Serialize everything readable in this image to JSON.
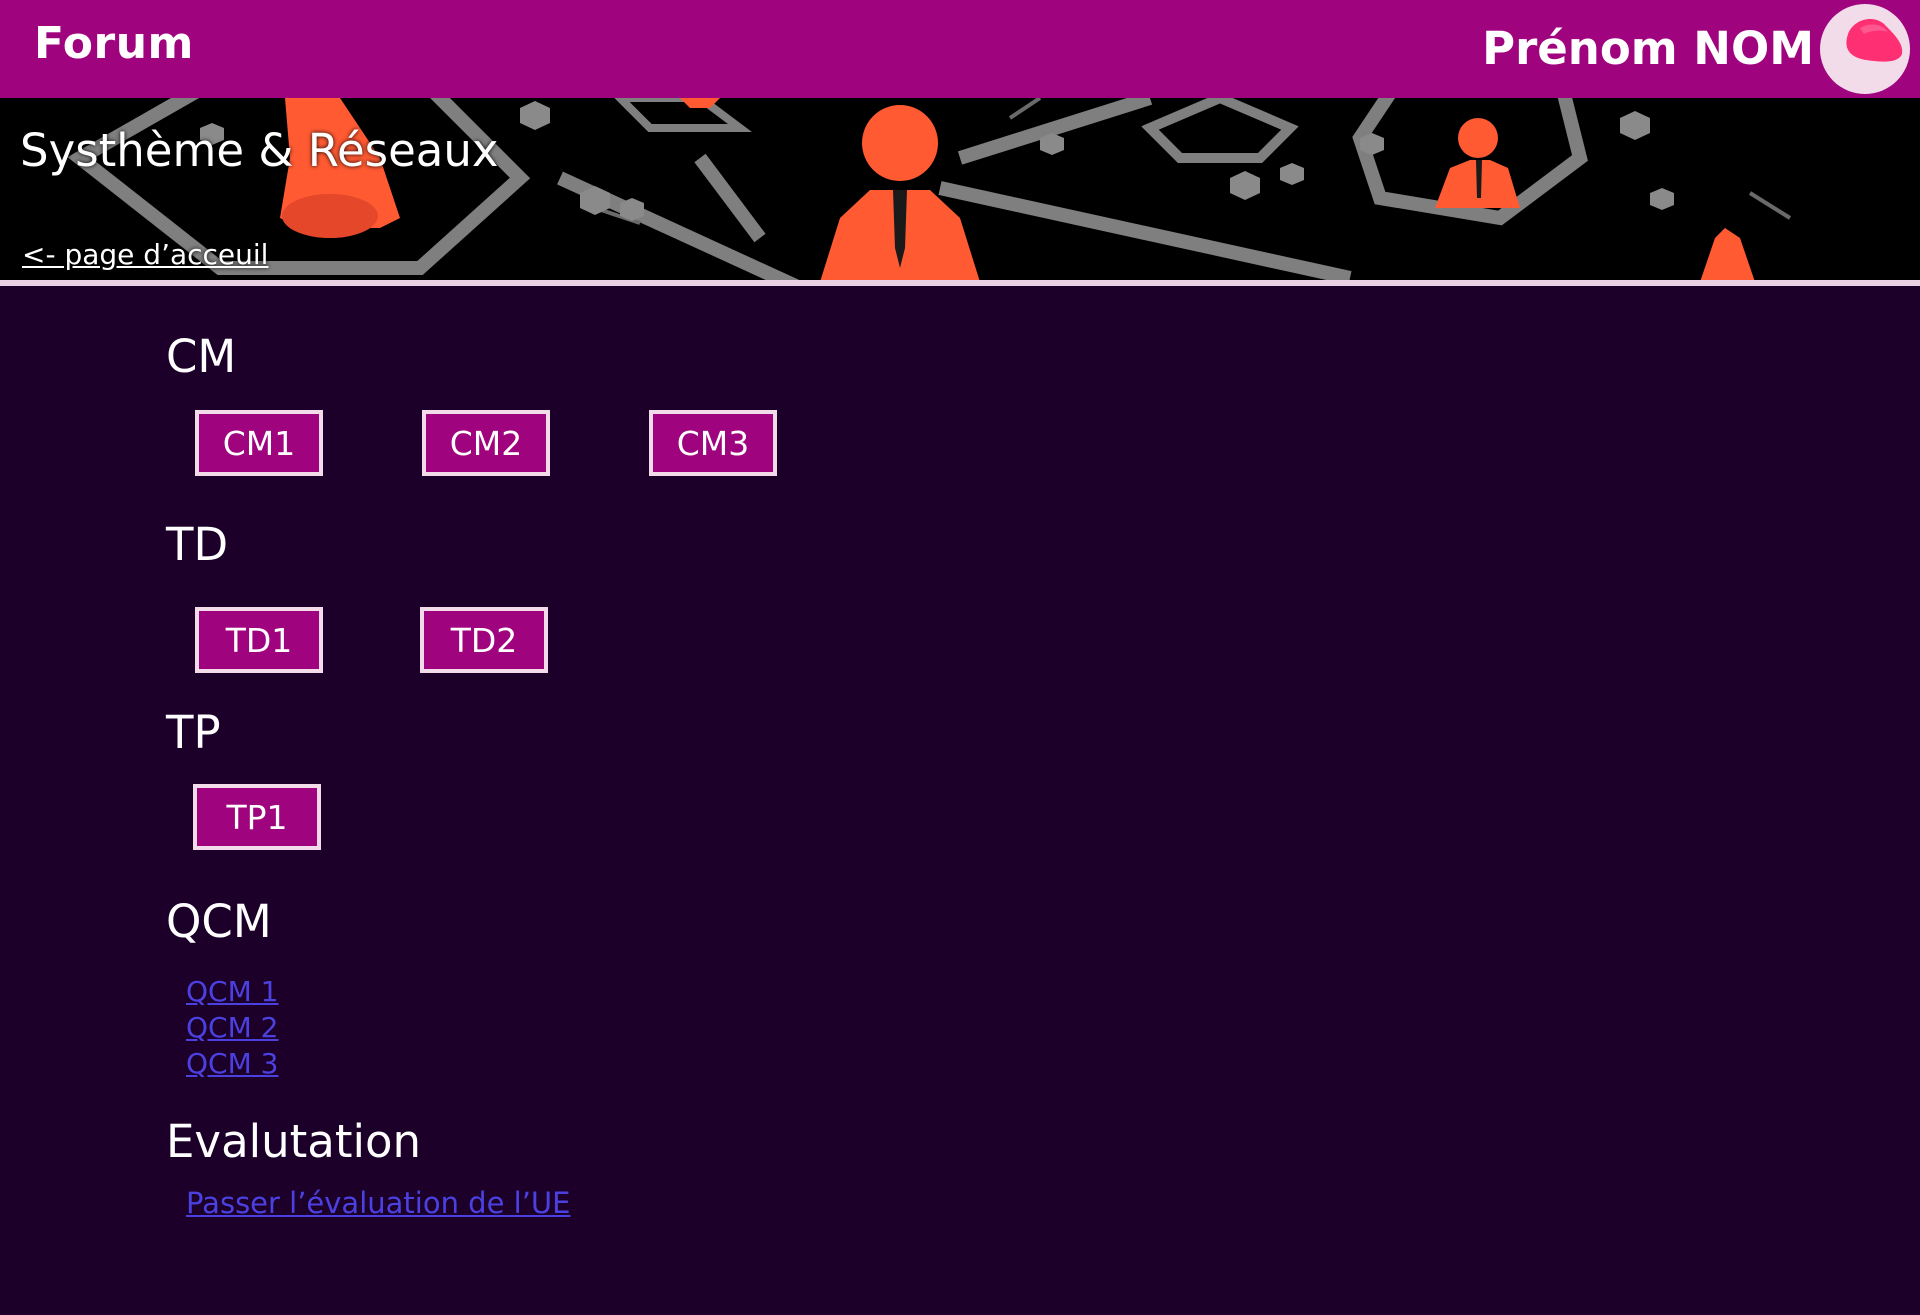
{
  "header": {
    "title": "Forum",
    "user_name": "Prénom NOM"
  },
  "banner": {
    "title": "Systhème & Réseaux",
    "back_link": "<- page d’acceuil"
  },
  "sections": {
    "cm": {
      "heading": "CM",
      "buttons": [
        "CM1",
        "CM2",
        "CM3"
      ]
    },
    "td": {
      "heading": "TD",
      "buttons": [
        "TD1",
        "TD2"
      ]
    },
    "tp": {
      "heading": "TP",
      "buttons": [
        "TP1"
      ]
    },
    "qcm": {
      "heading": "QCM",
      "links": [
        "QCM 1",
        "QCM 2",
        "QCM 3"
      ]
    },
    "evaluation": {
      "heading": "Evalutation",
      "link": "Passer l’évaluation de l’UE"
    }
  },
  "colors": {
    "brand": "#a0037e",
    "background": "#1c0029",
    "button_border": "#f3dcea",
    "link": "#4b40e0"
  }
}
